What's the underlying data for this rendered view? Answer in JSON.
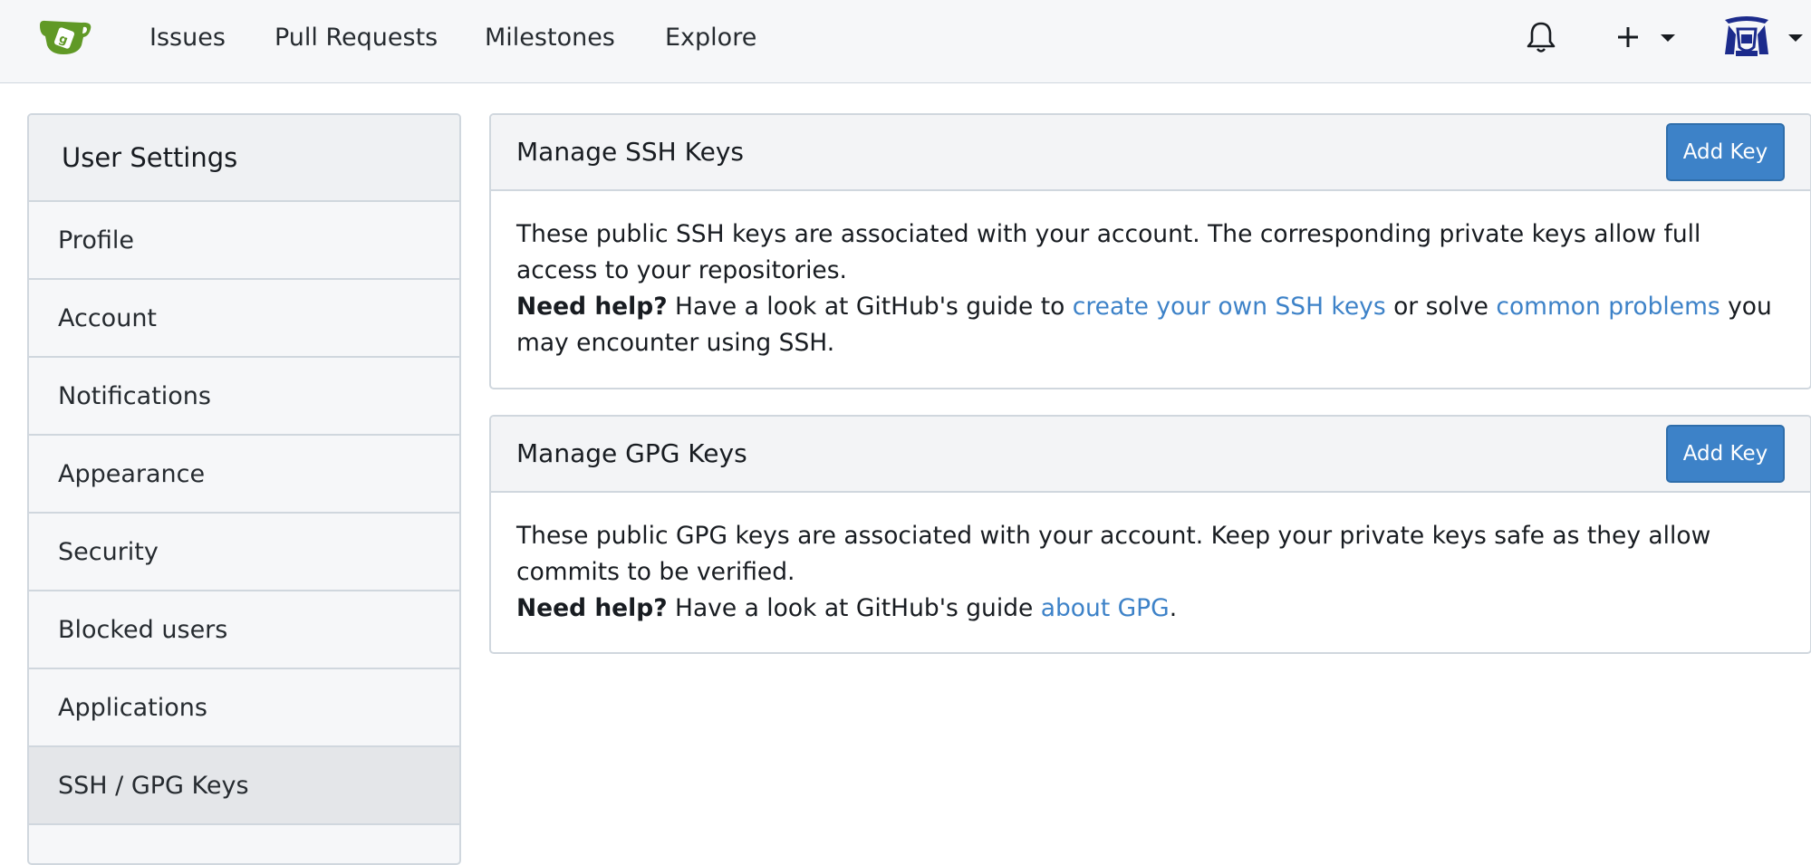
{
  "navbar": {
    "links": [
      "Issues",
      "Pull Requests",
      "Milestones",
      "Explore"
    ],
    "icons": {
      "logo": "gitea-teacup-logo",
      "notifications": "bell-icon",
      "create": "plus-icon",
      "user": "avatar"
    },
    "colors": {
      "logo": "#609926",
      "background": "#f6f7f9"
    }
  },
  "sidebar": {
    "title": "User Settings",
    "items": [
      {
        "label": "Profile",
        "active": false
      },
      {
        "label": "Account",
        "active": false
      },
      {
        "label": "Notifications",
        "active": false
      },
      {
        "label": "Appearance",
        "active": false
      },
      {
        "label": "Security",
        "active": false
      },
      {
        "label": "Blocked users",
        "active": false
      },
      {
        "label": "Applications",
        "active": false
      },
      {
        "label": "SSH / GPG Keys",
        "active": true
      }
    ]
  },
  "ssh": {
    "title": "Manage SSH Keys",
    "button": "Add Key",
    "description": "These public SSH keys are associated with your account. The corresponding private keys allow full access to your repositories.",
    "help_label": "Need help?",
    "help_pre": " Have a look at GitHub's guide to ",
    "help_link1": "create your own SSH keys",
    "help_mid": " or solve ",
    "help_link2": "common problems",
    "help_post": " you may encounter using SSH."
  },
  "gpg": {
    "title": "Manage GPG Keys",
    "button": "Add Key",
    "description": "These public GPG keys are associated with your account. Keep your private keys safe as they allow commits to be verified.",
    "help_label": "Need help?",
    "help_pre": " Have a look at GitHub's guide ",
    "help_link": "about GPG",
    "help_post": "."
  },
  "theme": {
    "accent": "#3d82c8",
    "border": "#d0d7de"
  }
}
